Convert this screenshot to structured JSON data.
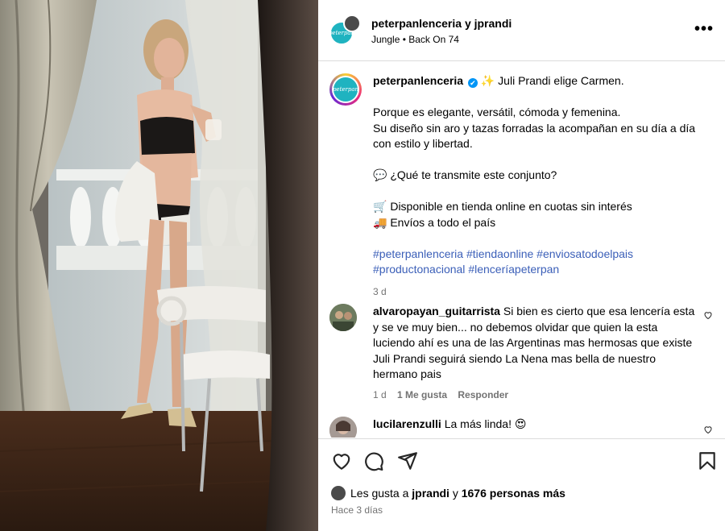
{
  "header": {
    "username": "peterpanlenceria y jprandi",
    "audio": "Jungle • Back On 74",
    "more_label": "•••",
    "brand_logo_text": "peterpan"
  },
  "caption": {
    "username": "peterpanlenceria",
    "verified_icon": "✔",
    "intro_emoji": "✨",
    "intro_text": "Juli Prandi elige Carmen.",
    "line1": "Porque es elegante, versátil, cómoda y femenina.",
    "line2": "Su diseño sin aro y tazas forradas la acompañan en su día a día con estilo y libertad.",
    "question_emoji": "💬",
    "question": "¿Qué te transmite este conjunto?",
    "cart_emoji": "🛒",
    "available": "Disponible en tienda online en cuotas sin interés",
    "truck_emoji": "🚚",
    "shipping": "Envíos a todo el país",
    "hashtags": [
      "#peterpanlenceria",
      "#tiendaonline",
      "#enviosatodoelpais",
      "#productonacional",
      "#lenceríapeterpan"
    ],
    "time": "3 d"
  },
  "comments": [
    {
      "username": "alvaropayan_guitarrista",
      "text": "Si bien es cierto que esa lencería esta y se ve muy bien... no debemos olvidar que quien la esta luciendo ahí es una de las Argentinas mas hermosas que existe Juli Prandi seguirá siendo La Nena mas bella de nuestro hermano pais",
      "time": "1 d",
      "likes": "1 Me gusta",
      "reply": "Responder"
    },
    {
      "username": "lucilarenzulli",
      "text": "La más linda!",
      "emoji": "😍"
    }
  ],
  "footer": {
    "likes_prefix": "Les gusta a",
    "likes_user": "jprandi",
    "likes_connector": "y",
    "likes_count": "1676 personas más",
    "date": "Hace 3 días"
  },
  "icons": {
    "like": "heart-icon",
    "comment": "comment-icon",
    "share": "share-icon",
    "save": "bookmark-icon"
  },
  "colors": {
    "brand": "#1fb3c0",
    "link": "#00376b",
    "verified": "#0095f6",
    "muted": "#737373"
  }
}
